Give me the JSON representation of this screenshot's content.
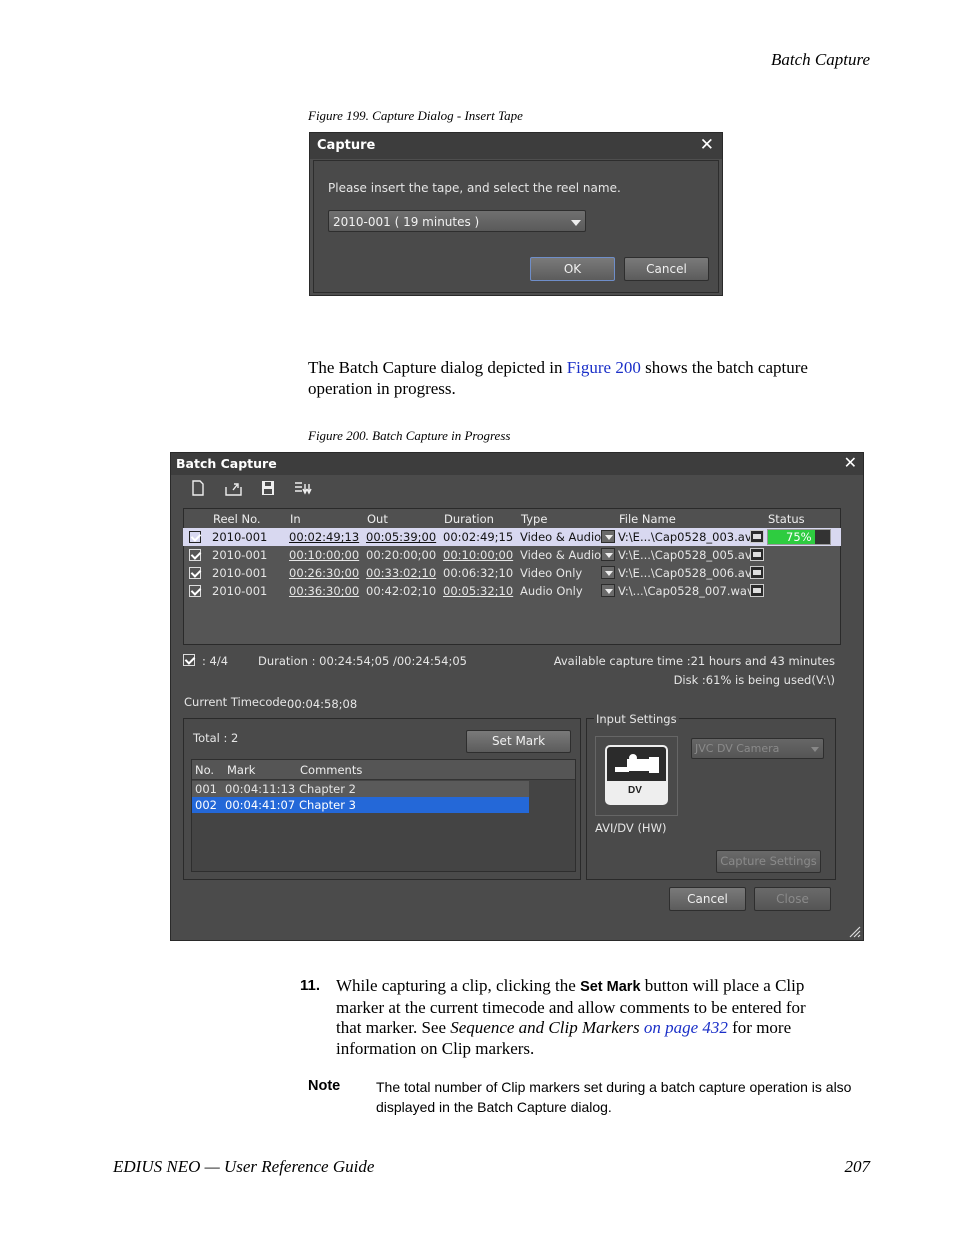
{
  "header": {
    "section": "Batch Capture"
  },
  "figure199": {
    "caption": "Figure 199.  Capture Dialog - Insert Tape",
    "dialog": {
      "title": "Capture",
      "message": "Please insert the tape, and select the reel name.",
      "reel_value": "2010-001 ( 19 minutes )",
      "ok_label": "OK",
      "cancel_label": "Cancel"
    }
  },
  "intro": {
    "before_link": "The Batch Capture dialog depicted in ",
    "link": "Figure 200",
    "after_link": " shows the batch capture",
    "line2": "operation in progress."
  },
  "figure200": {
    "caption": "Figure 200.  Batch Capture in Progress",
    "dialog": {
      "title": "Batch Capture",
      "toolbar_icons": [
        "new-icon",
        "import-icon",
        "save-icon",
        "export-icon"
      ],
      "columns": [
        "Reel No.",
        "In",
        "Out",
        "Duration",
        "Type",
        "File Name",
        "Status"
      ],
      "rows": [
        {
          "reel": "2010-001",
          "in": "00:02:49;13",
          "out": "00:05:39;00",
          "duration": "00:02:49;15",
          "type": "Video & Audio",
          "file": "V:\\E...\\Cap0528_003.avi",
          "status": "75%",
          "progress": 0.75
        },
        {
          "reel": "2010-001",
          "in": "00:10:00;00",
          "out": "00:20:00;00",
          "duration": "00:10:00;00",
          "type": "Video & Audio",
          "file": "V:\\E...\\Cap0528_005.avi",
          "status": ""
        },
        {
          "reel": "2010-001",
          "in": "00:26:30;00",
          "out": "00:33:02;10",
          "duration": "00:06:32;10",
          "type": "Video Only",
          "file": "V:\\E...\\Cap0528_006.avi",
          "status": ""
        },
        {
          "reel": "2010-001",
          "in": "00:36:30;00",
          "out": "00:42:02;10",
          "duration": "00:05:32;10",
          "type": "Audio Only",
          "file": "V:\\...\\Cap0528_007.wav",
          "status": ""
        }
      ],
      "count": ": 4/4",
      "duration_summary": "Duration : 00:24:54;05 /00:24:54;05",
      "available": "Available capture time :21 hours and 43 minutes",
      "disk": "Disk :61% is being used(V:\\)",
      "timecode_label": "Current Timecode :",
      "timecode_value": "00:04:58;08",
      "total": "Total : 2",
      "set_mark_label": "Set Mark",
      "marker_columns": [
        "No.",
        "Mark",
        "Comments"
      ],
      "markers": [
        {
          "no": "001",
          "mark": "00:04:11:13",
          "comment": "Chapter 2"
        },
        {
          "no": "002",
          "mark": "00:04:41:07",
          "comment": "Chapter 3"
        }
      ],
      "input_settings_label": "Input Settings",
      "dv_label": "DV",
      "device_label": "AVI/DV (HW)",
      "camera_value": "JVC DV Camera",
      "capture_settings_label": "Capture Settings",
      "cancel_label": "Cancel",
      "close_label": "Close"
    }
  },
  "step": {
    "number": "11.",
    "line1_before": "While capturing a clip, clicking the ",
    "line1_bold": "Set Mark",
    "line1_after": " button will place a Clip",
    "line2": "marker at the current timecode and allow comments to be entered for",
    "line3_before": "that marker. See ",
    "line3_italic": "Sequence and Clip Markers",
    "line3_link": " on page 432",
    "line3_after": " for more",
    "line4": "information on Clip markers."
  },
  "note": {
    "label": "Note",
    "line1": "The total number of Clip markers set during a batch capture operation is also",
    "line2": "displayed in the Batch Capture dialog."
  },
  "footer": {
    "title": "EDIUS NEO  —  User Reference Guide",
    "page": "207"
  },
  "colors": {
    "accent_link": "#1a2fc8",
    "progress_green": "#2ecc40",
    "selection_blue": "#2468d8"
  }
}
